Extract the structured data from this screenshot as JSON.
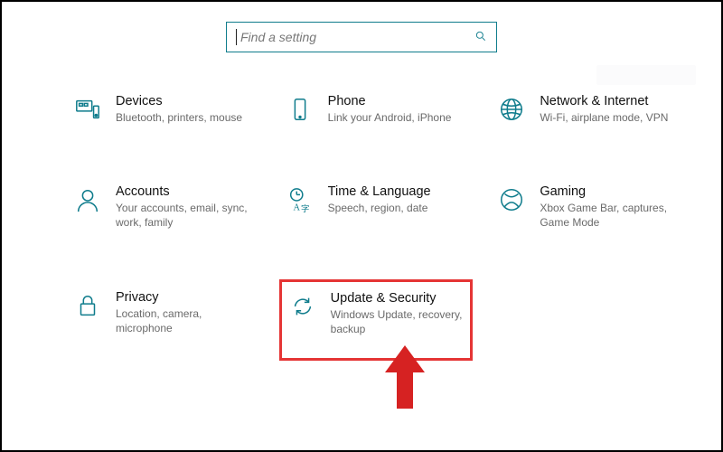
{
  "accent": "#0f7c8c",
  "highlight_color": "#e53535",
  "search": {
    "placeholder": "Find a setting"
  },
  "tiles": {
    "devices": {
      "title": "Devices",
      "desc": "Bluetooth, printers, mouse"
    },
    "phone": {
      "title": "Phone",
      "desc": "Link your Android, iPhone"
    },
    "network": {
      "title": "Network & Internet",
      "desc": "Wi-Fi, airplane mode, VPN"
    },
    "accounts": {
      "title": "Accounts",
      "desc": "Your accounts, email, sync, work, family"
    },
    "time": {
      "title": "Time & Language",
      "desc": "Speech, region, date"
    },
    "gaming": {
      "title": "Gaming",
      "desc": "Xbox Game Bar, captures, Game Mode"
    },
    "privacy": {
      "title": "Privacy",
      "desc": "Location, camera, microphone"
    },
    "update": {
      "title": "Update & Security",
      "desc": "Windows Update, recovery, backup"
    }
  }
}
